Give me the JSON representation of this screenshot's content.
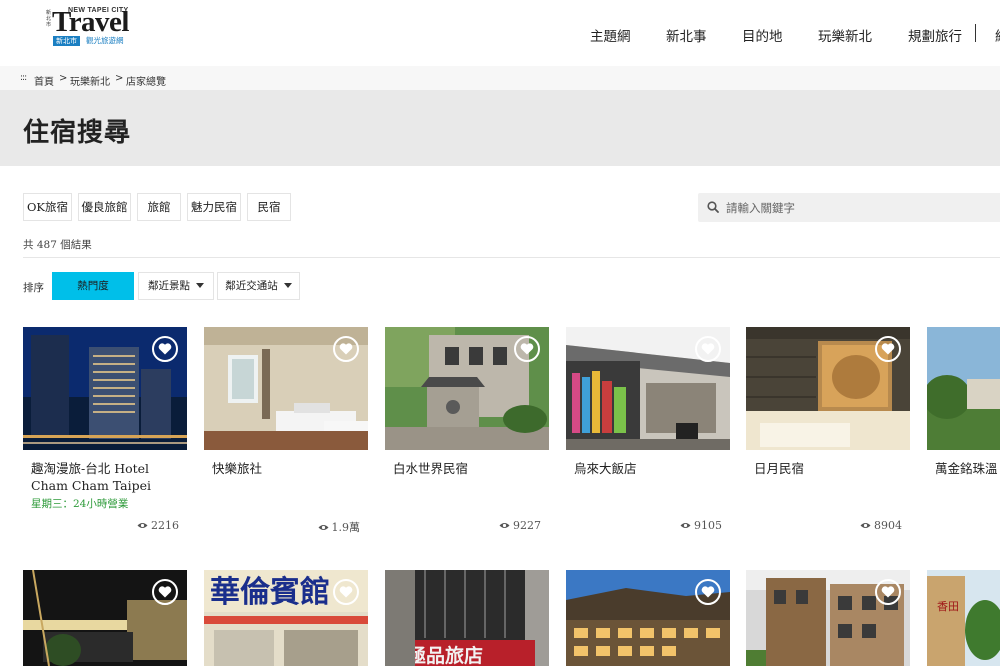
{
  "header": {
    "logo": {
      "side_text": "新北市",
      "top_text": "NEW TAPEI CITY",
      "main": "Travel",
      "city_tag": "新北市",
      "subtitle": "觀光旅遊網"
    },
    "nav": [
      "主題網",
      "新北事",
      "目的地",
      "玩樂新北",
      "規劃旅行"
    ],
    "nav_cut_text": "網"
  },
  "breadcrumb": {
    "icon": ":::",
    "items": [
      "首頁",
      "玩樂新北",
      "店家總覽"
    ],
    "separator": ">"
  },
  "page_title": "住宿搜尋",
  "filters": [
    "OK旅宿",
    "優良旅館",
    "旅館",
    "魅力民宿",
    "民宿"
  ],
  "search": {
    "placeholder": "請輸入關鍵字",
    "value": ""
  },
  "result_count": "共 487 個結果",
  "sort": {
    "label": "排序",
    "options": [
      "熱門度",
      "鄰近景點",
      "鄰近交通站"
    ],
    "active": "熱門度"
  },
  "cards": [
    {
      "name": "趣淘漫旅-台北 Hotel Cham Cham Taipei",
      "hours": "星期三：24小時營業",
      "views": "2216"
    },
    {
      "name": "快樂旅社",
      "views": "1.9萬"
    },
    {
      "name": "白水世界民宿",
      "views": "9227"
    },
    {
      "name": "烏來大飯店",
      "views": "9105"
    },
    {
      "name": "日月民宿",
      "views": "8904"
    },
    {
      "name": "萬金銘珠溫"
    }
  ],
  "row2_cards": [
    {
      "image_text": "華倫賓館"
    },
    {
      "image_text": "極品旅店"
    },
    {
      "image_text": "香田"
    }
  ],
  "colors": {
    "accent": "#00bfe9",
    "hours_green": "#2e9b3a",
    "title_band": "#e9e9e9",
    "logo_blue": "#1b7fc2"
  }
}
